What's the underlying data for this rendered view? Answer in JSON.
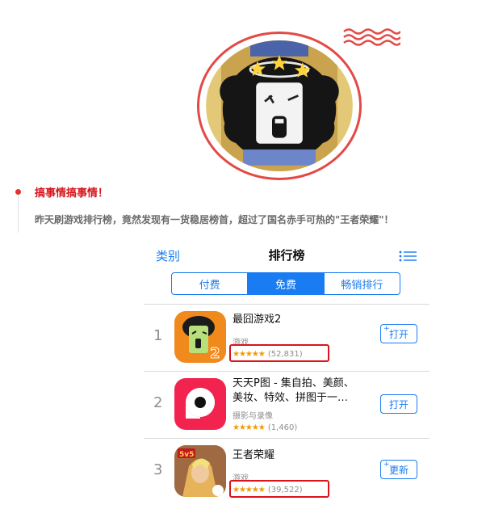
{
  "post": {
    "title": "搞事情搞事情！",
    "text": "昨天刷游戏排行榜，竟然发现有一货稳居榜首，超过了国名赤手可热的\"王者荣耀\"！"
  },
  "store": {
    "nav_left": "类别",
    "nav_title": "排行榜",
    "nav_right_icon": "list-icon",
    "segments": [
      {
        "label": "付费",
        "active": false
      },
      {
        "label": "免费",
        "active": true
      },
      {
        "label": "畅销排行",
        "active": false
      }
    ],
    "apps": [
      {
        "rank": "1",
        "name": "最囧游戏2",
        "category": "游戏",
        "stars": "★★★★★",
        "rating_count": "(52,831)",
        "button": "打开",
        "button_plus": "+",
        "highlighted": true
      },
      {
        "rank": "2",
        "name": "天天P图 - 集自拍、美颜、美妆、特效、拼图于一…",
        "category": "摄影与录像",
        "stars": "★★★★★",
        "rating_count": "(1,460)",
        "button": "打开",
        "button_plus": "",
        "highlighted": false
      },
      {
        "rank": "3",
        "name": "王者荣耀",
        "category": "游戏",
        "stars": "★★★★★",
        "rating_count": "(39,522)",
        "button": "更新",
        "button_plus": "+",
        "highlighted": true
      }
    ]
  },
  "colors": {
    "accent_blue": "#1a7cf2",
    "highlight_red": "#d9141c",
    "title_red": "#d8141c",
    "star_orange": "#f29a00"
  }
}
